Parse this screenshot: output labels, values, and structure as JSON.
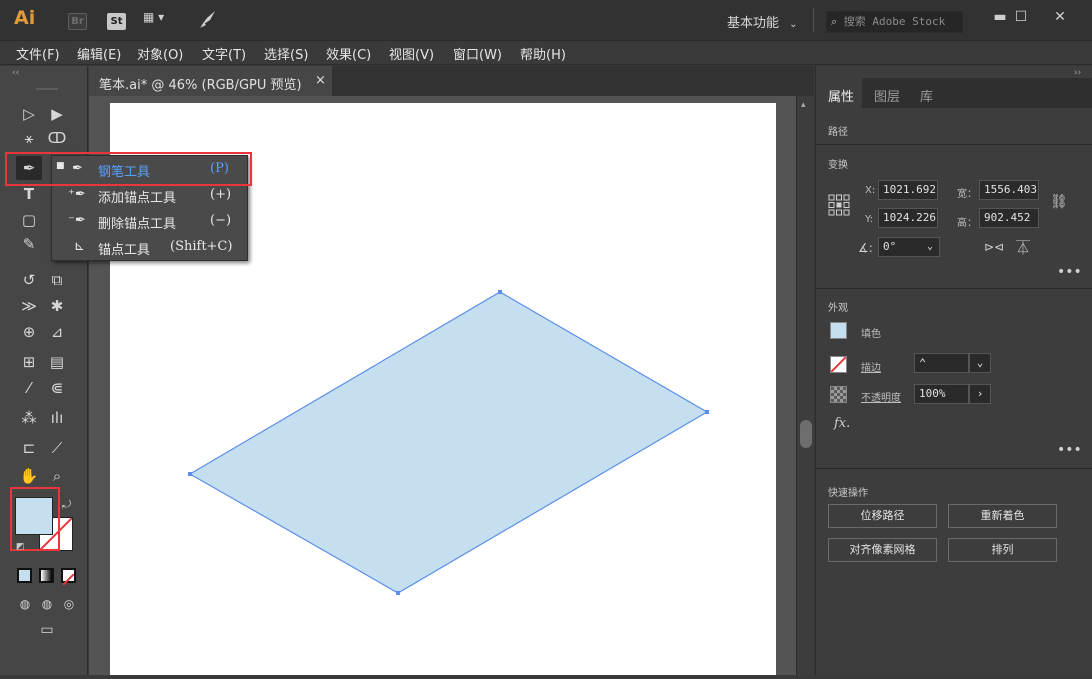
{
  "title_bar": {
    "logo": "Ai",
    "bridge_badge": "Br",
    "stock_badge": "St",
    "layout_switcher": "▦ ▾",
    "workspace_label": "基本功能",
    "search_placeholder": "搜索 Adobe Stock",
    "minimize": "▬",
    "maximize": "☐",
    "close": "✕"
  },
  "menu": [
    "文件(F)",
    "编辑(E)",
    "对象(O)",
    "文字(T)",
    "选择(S)",
    "效果(C)",
    "视图(V)",
    "窗口(W)",
    "帮助(H)"
  ],
  "document_tab": {
    "title": "笔本.ai* @ 46% (RGB/GPU 预览)",
    "close": "×"
  },
  "pen_flyout": [
    {
      "label": "钢笔工具",
      "shortcut": "(P)",
      "selected": true,
      "icon": "pen-icon"
    },
    {
      "label": "添加锚点工具",
      "shortcut": "(+)",
      "selected": false,
      "icon": "add-anchor-icon"
    },
    {
      "label": "删除锚点工具",
      "shortcut": "(−)",
      "selected": false,
      "icon": "delete-anchor-icon"
    },
    {
      "label": "锚点工具",
      "shortcut": "(Shift+C)",
      "selected": false,
      "icon": "anchor-point-icon"
    }
  ],
  "right_panel": {
    "tabs": [
      "属性",
      "图层",
      "库"
    ],
    "active_tab": "属性",
    "object_type": "路径",
    "transform": {
      "title": "变换",
      "x_label": "X:",
      "x": "1021.692",
      "y_label": "Y:",
      "y": "1024.226",
      "w_label": "宽：",
      "w": "1556.403",
      "h_label": "高：",
      "h": "902.452",
      "angle": "0°"
    },
    "appearance": {
      "title": "外观",
      "fill_label": "填色",
      "stroke_label": "描边",
      "opacity_label": "不透明度",
      "opacity": "100%",
      "fx": "fx."
    },
    "quick_actions": {
      "title": "快速操作",
      "buttons": [
        "位移路径",
        "重新着色",
        "对齐像素网格",
        "排列"
      ]
    }
  },
  "colors": {
    "shape_fill": "#c5def0",
    "shape_stroke": "#5b8fe8",
    "highlight": "#e8363b",
    "accent_text": "#5aa0ff"
  }
}
